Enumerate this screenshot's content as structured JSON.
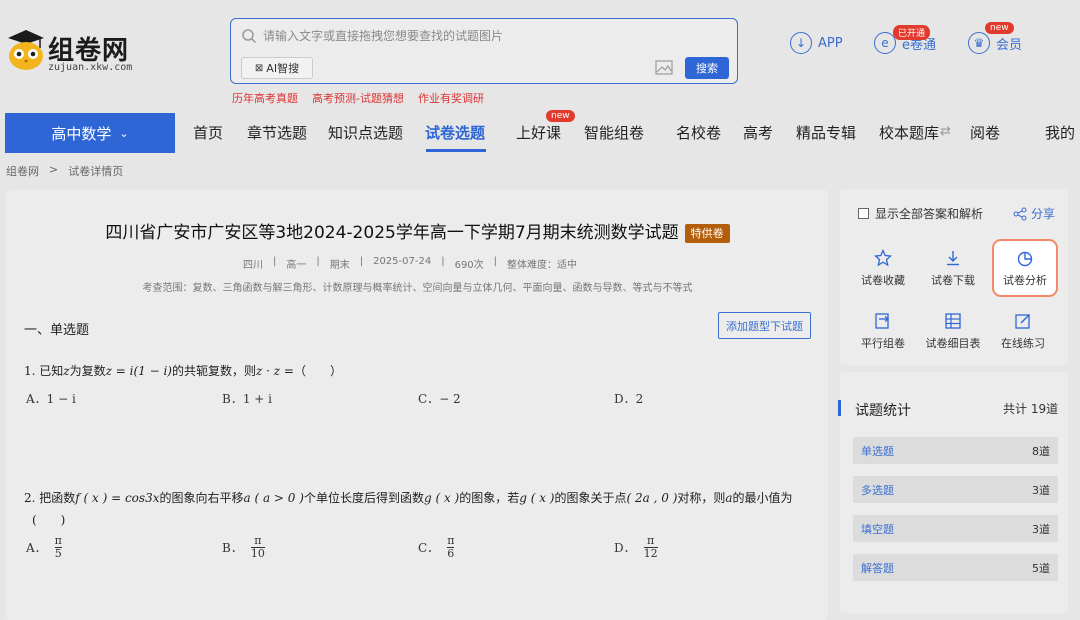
{
  "logo": {
    "name": "组卷网",
    "domain": "zujuan.xkw.com"
  },
  "search": {
    "placeholder": "请输入文字或直接拖拽您想要查找的试题图片",
    "ai_label": "AI智搜",
    "button": "搜索"
  },
  "hot_links": [
    "历年高考真题",
    "高考预测-试题猜想",
    "作业有奖调研"
  ],
  "top_right": {
    "app": "APP",
    "eJuan": {
      "label": "e卷通",
      "badge": "已开通"
    },
    "member": {
      "label": "会员",
      "badge": "new"
    }
  },
  "subject": "高中数学",
  "nav": {
    "home": "首页",
    "chapter": "章节选题",
    "knowledge": "知识点选题",
    "paper": "试卷选题",
    "lesson": "上好课",
    "lesson_badge": "new",
    "smart": "智能组卷",
    "school": "名校卷",
    "gaokao": "高考",
    "special": "精品专辑",
    "school_bank": "校本题库",
    "reading": "阅卷",
    "mine": "我的"
  },
  "breadcrumb": {
    "home": "组卷网",
    "sep": ">",
    "current": "试卷详情页"
  },
  "paper": {
    "title": "四川省广安市广安区等3地2024-2025学年高一下学期7月期末统测数学试题",
    "tag": "特供卷",
    "meta": [
      "四川",
      "高一",
      "期末",
      "2025-07-24",
      "690次",
      "整体难度：适中"
    ],
    "scope": "考查范围：复数、三角函数与解三角形、计数原理与概率统计、空间向量与立体几何、平面向量、函数与导数、等式与不等式"
  },
  "section": {
    "title": "一、单选题",
    "add_button": "添加题型下试题"
  },
  "q1": {
    "a": "1. 已知",
    "b": "为复数",
    "c": "的共轭复数，则",
    "d": "（　　）",
    "var_z": "z",
    "eq": "z = i(1 − i)",
    "expr": "z · z =",
    "options": {
      "A": "1 − i",
      "B": "1 + i",
      "C": "− 2",
      "D": "2"
    }
  },
  "q2": {
    "a": "2. 把函数",
    "f": "f ( x ) = cos3x",
    "b": "的图象向右平移",
    "shift": "a ( a > 0 )",
    "c": "个单位长度后得到函数",
    "g": "g ( x )",
    "d": "的图象，若",
    "e": "的图象关于点",
    "point": "( 2a , 0 )",
    "h": "对称，则",
    "var_a": "a",
    "i": "的最小值为",
    "paren": "(　　)",
    "pi": "π",
    "options": {
      "A": "5",
      "B": "10",
      "C": "6",
      "D": "12"
    }
  },
  "opt_labels": {
    "A": "A．",
    "B": "B．",
    "C": "C．",
    "D": "D．"
  },
  "sidebar": {
    "show_all": "显示全部答案和解析",
    "share": "分享",
    "tools": [
      "试卷收藏",
      "试卷下载",
      "试卷分析",
      "平行组卷",
      "试卷细目表",
      "在线练习"
    ]
  },
  "stats": {
    "title": "试题统计",
    "total": "共计 19道",
    "rows": [
      {
        "name": "单选题",
        "count": "8道"
      },
      {
        "name": "多选题",
        "count": "3道"
      },
      {
        "name": "填空题",
        "count": "3道"
      },
      {
        "name": "解答题",
        "count": "5道"
      }
    ]
  }
}
